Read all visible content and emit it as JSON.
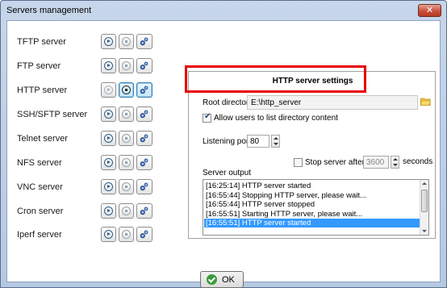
{
  "window": {
    "title": "Servers management",
    "close_icon": "close-x-icon"
  },
  "servers": [
    {
      "name": "TFTP server",
      "running": false
    },
    {
      "name": "FTP server",
      "running": false
    },
    {
      "name": "HTTP server",
      "running": true
    },
    {
      "name": "SSH/SFTP server",
      "running": false
    },
    {
      "name": "Telnet server",
      "running": false
    },
    {
      "name": "NFS server",
      "running": false
    },
    {
      "name": "VNC server",
      "running": false
    },
    {
      "name": "Cron server",
      "running": false
    },
    {
      "name": "Iperf server",
      "running": false
    }
  ],
  "settings": {
    "title": "HTTP server settings",
    "root_label": "Root directory",
    "root_value": "E:\\http_server",
    "list_dir_label": "Allow users to list directory content",
    "list_dir_checked": true,
    "port_label": "Listening port",
    "port_value": "80",
    "stop_after_label": "Stop server after",
    "stop_after_checked": false,
    "stop_after_value": "3600",
    "seconds_label": "seconds",
    "output_label": "Server output",
    "output_lines": [
      "[16:25:14] HTTP server started",
      "[16:55:44] Stopping HTTP server, please wait...",
      "[16:55:44] HTTP server stopped",
      "[16:55:51] Starting HTTP server, please wait...",
      "[16:55:51] HTTP server started"
    ],
    "selected_line": 4
  },
  "ok_label": "OK",
  "colors": {
    "highlight": "#e60000",
    "selection": "#3399ff",
    "ok_icon": "#3a9b3a"
  }
}
